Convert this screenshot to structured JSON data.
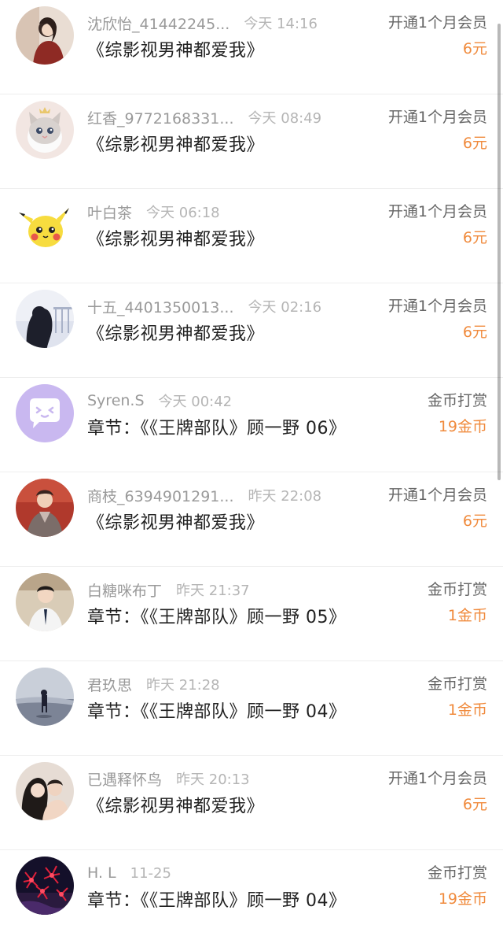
{
  "records": [
    {
      "name": "沈欣怡_41442245...",
      "time": "今天 14:16",
      "content": "《综影视男神都爱我》",
      "type": "开通1个月会员",
      "amount": "6元",
      "avatar_icon": "woman-avatar-icon"
    },
    {
      "name": "红香_9772168331...",
      "time": "今天 08:49",
      "content": "《综影视男神都爱我》",
      "type": "开通1个月会员",
      "amount": "6元",
      "avatar_icon": "cat-avatar-icon"
    },
    {
      "name": "叶白茶",
      "time": "今天 06:18",
      "content": "《综影视男神都爱我》",
      "type": "开通1个月会员",
      "amount": "6元",
      "avatar_icon": "pikachu-avatar-icon"
    },
    {
      "name": "十五_4401350013...",
      "time": "今天 02:16",
      "content": "《综影视男神都爱我》",
      "type": "开通1个月会员",
      "amount": "6元",
      "avatar_icon": "girl-avatar-icon"
    },
    {
      "name": "Syren.S",
      "time": "今天 00:42",
      "content": "章节：《《王牌部队》顾一野 06》",
      "type": "金币打赏",
      "amount": "19金币",
      "avatar_icon": "chat-bubble-avatar-icon"
    },
    {
      "name": "商枝_6394901291...",
      "time": "昨天 22:08",
      "content": "《综影视男神都爱我》",
      "type": "开通1个月会员",
      "amount": "6元",
      "avatar_icon": "man-avatar-icon"
    },
    {
      "name": "白糖咪布丁",
      "time": "昨天 21:37",
      "content": "章节：《《王牌部队》顾一野 05》",
      "type": "金币打赏",
      "amount": "1金币",
      "avatar_icon": "boy-avatar-icon"
    },
    {
      "name": "君玖思",
      "time": "昨天 21:28",
      "content": "章节：《《王牌部队》顾一野 04》",
      "type": "金币打赏",
      "amount": "1金币",
      "avatar_icon": "beach-avatar-icon"
    },
    {
      "name": "已遇释怀鸟",
      "time": "昨天 20:13",
      "content": "《综影视男神都爱我》",
      "type": "开通1个月会员",
      "amount": "6元",
      "avatar_icon": "couple-avatar-icon"
    },
    {
      "name": "H. L",
      "time": "11-25",
      "content": "章节：《《王牌部队》顾一野 04》",
      "type": "金币打赏",
      "amount": "19金币",
      "avatar_icon": "flower-avatar-icon"
    }
  ],
  "colors": {
    "amount": "#f08a3c",
    "name": "#9a9a9a",
    "content": "#222222"
  }
}
